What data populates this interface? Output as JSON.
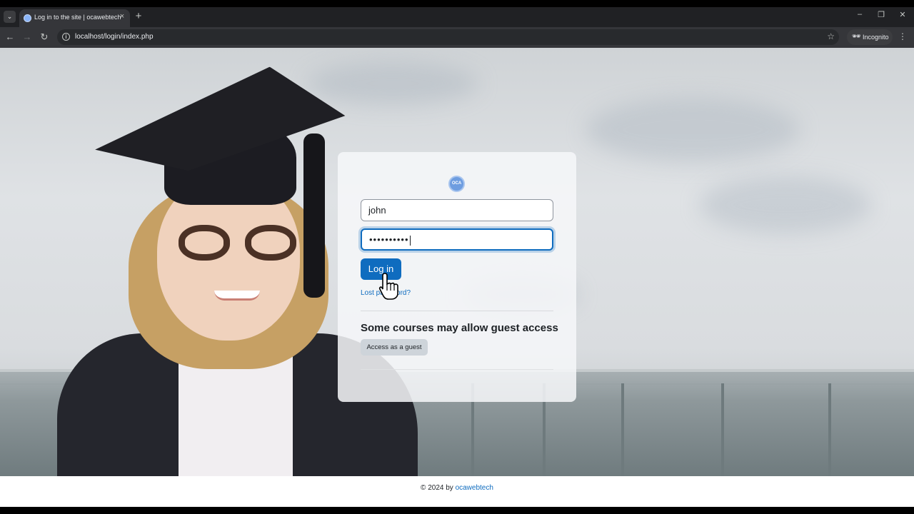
{
  "browser": {
    "tab_title": "Log in to the site | ocawebtech",
    "tab_close": "×",
    "new_tab": "+",
    "url": "localhost/login/index.php",
    "incognito_label": "Incognito",
    "window_controls": {
      "minimize": "–",
      "restore": "❐",
      "close": "✕"
    }
  },
  "login": {
    "logo_text": "OCA",
    "username_value": "john",
    "password_mask": "••••••••••",
    "login_button": "Log in",
    "lost_password": "Lost password?",
    "guest_heading": "Some courses may allow guest access",
    "guest_button": "Access as a guest"
  },
  "footer": {
    "copyright": "© 2024 by ",
    "link": "ocawebtech"
  },
  "colors": {
    "accent": "#0f6cbf",
    "browser_dark": "#202124"
  }
}
